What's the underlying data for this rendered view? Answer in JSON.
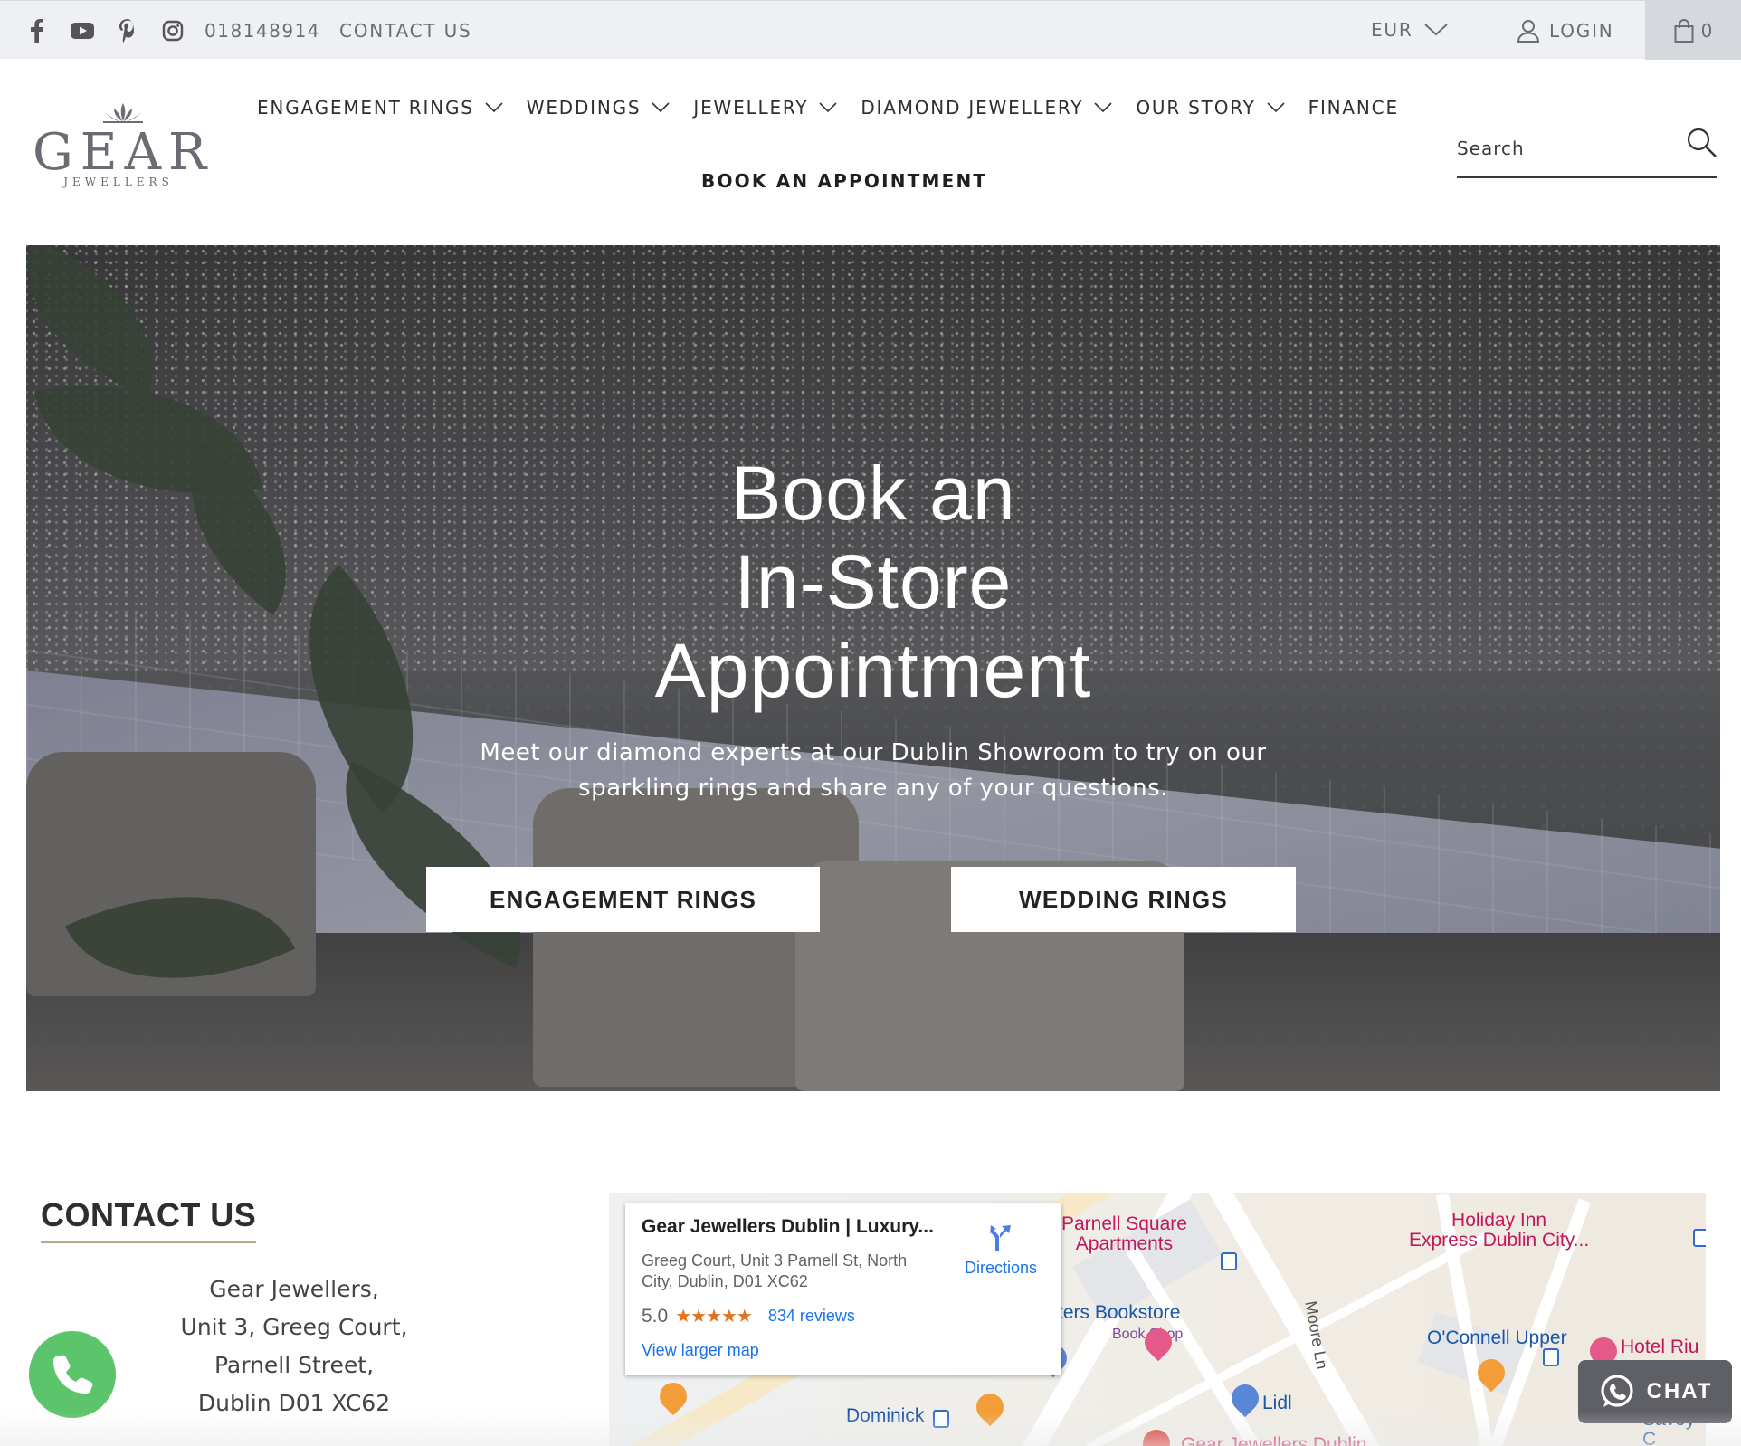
{
  "topbar": {
    "social_icons": [
      "facebook-icon",
      "youtube-icon",
      "pinterest-icon",
      "instagram-icon"
    ],
    "phone": "018148914",
    "contact_link": "CONTACT US",
    "currency": "EUR",
    "login": "LOGIN",
    "cart_count": "0"
  },
  "header": {
    "logo_text": "GEAR",
    "logo_subtext": "JEWELLERS",
    "nav": [
      {
        "label": "ENGAGEMENT RINGS",
        "has_dropdown": true
      },
      {
        "label": "WEDDINGS",
        "has_dropdown": true
      },
      {
        "label": "JEWELLERY",
        "has_dropdown": true
      },
      {
        "label": "DIAMOND JEWELLERY",
        "has_dropdown": true
      },
      {
        "label": "OUR STORY",
        "has_dropdown": true
      },
      {
        "label": "FINANCE",
        "has_dropdown": false
      }
    ],
    "book_appointment": "BOOK AN APPOINTMENT",
    "search_placeholder": "Search"
  },
  "hero": {
    "title_line1": "Book an",
    "title_line2": "In-Store",
    "title_line3": "Appointment",
    "subtitle_line1": "Meet our diamond experts at our Dublin Showroom to try on our",
    "subtitle_line2": "sparkling rings and share any of your questions.",
    "button_engagement": "ENGAGEMENT RINGS",
    "button_wedding": "WEDDING RINGS"
  },
  "contact": {
    "heading": "CONTACT US",
    "address_lines": [
      "Gear Jewellers,",
      "Unit 3, Greeg Court,",
      "Parnell Street,",
      "Dublin D01 XC62"
    ]
  },
  "map": {
    "card": {
      "name": "Gear Jewellers Dublin | Luxury...",
      "address_line1": "Greeg Court, Unit 3 Parnell St, North",
      "address_line2": "City, Dublin, D01 XC62",
      "rating": "5.0",
      "stars": "★★★★★",
      "reviews": "834 reviews",
      "view_larger": "View larger map",
      "directions": "Directions"
    },
    "labels": {
      "parnell_1": "Parnell Square",
      "parnell_2": "Apartments",
      "holiday_1": "Holiday Inn",
      "holiday_2": "Express Dublin City...",
      "bookstore": "ters Bookstore",
      "bookshop": "Book Shop",
      "moore": "Moore Ln",
      "oconnell": "O'Connell Upper",
      "hotel": "Hotel Riu",
      "lidl": "Lidl",
      "dominick": "Dominick",
      "savoy": "Savoy C",
      "gear": "Gear Jewellers Dublin"
    }
  },
  "widgets": {
    "chat_label": "CHAT"
  },
  "colors": {
    "topbar_bg": "#eef0f3",
    "cart_bg": "#d5d9de",
    "call_green": "#5cc46b",
    "chat_bg": "#5f5f66",
    "link_blue": "#1a73e8",
    "star_orange": "#e7711b"
  }
}
